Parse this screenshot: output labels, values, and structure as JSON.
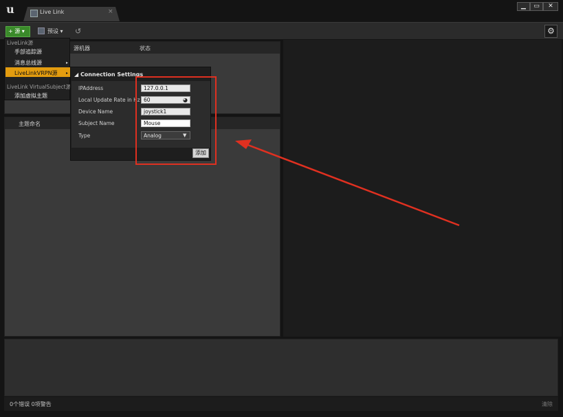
{
  "window": {
    "tab_title": "Live Link",
    "tab_close": "×",
    "minimize": "▁",
    "maximize": "▭",
    "close": "✕"
  },
  "toolbar": {
    "source_label": "+ 源 ▾",
    "presets_label": "预设 ▾",
    "undo_glyph": "↺",
    "settings_glyph": "⚙"
  },
  "source_list": {
    "col_machine": "源机器",
    "col_status": "状态"
  },
  "subject_list": {
    "col_subject": "主题命名"
  },
  "menu": {
    "section1_header": "LiveLink源",
    "items": [
      "手部追踪源",
      "消息总线源",
      "LiveLinkVRPN源"
    ],
    "section2_header": "LiveLink VirtualSubject源",
    "add_virtual": "添加虚拟主题",
    "arrow": "▸"
  },
  "connection": {
    "title": "◢ Connection Settings",
    "fields": [
      {
        "label": "IPAddress",
        "value": "127.0.0.1"
      },
      {
        "label": "Local Update Rate in Hz",
        "value": "60"
      },
      {
        "label": "Device Name",
        "value": "joystick1"
      },
      {
        "label": "Subject Name",
        "value": "Mouse"
      },
      {
        "label": "Type",
        "value": "Analog"
      }
    ],
    "add_button": "添加"
  },
  "status": {
    "text": "0个错误 0项警告",
    "clear": "清除"
  },
  "colors": {
    "accent_orange": "#e39c0f",
    "green_button": "#3a8a2a",
    "annotation_red": "#e03020"
  },
  "icons": [
    "ue-logo-icon",
    "livelink-tab-icon",
    "presets-icon",
    "undo-icon",
    "settings-icon",
    "submenu-arrow-icon",
    "spinner-icon",
    "dropdown-arrow-icon",
    "annotation-arrow-icon"
  ]
}
